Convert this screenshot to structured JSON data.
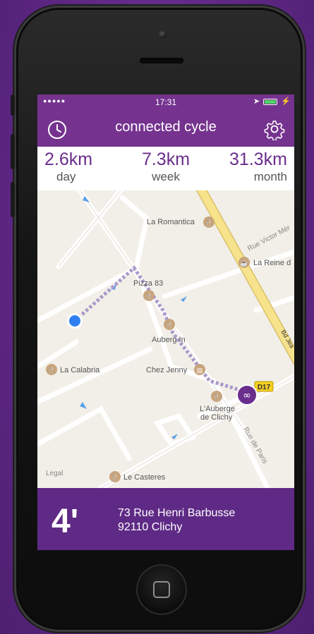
{
  "status_bar": {
    "signal": "●●●●●",
    "time": "17:31",
    "location_icon": "location-arrow-icon",
    "battery_icon": "battery-icon",
    "charging_icon": "bolt-icon"
  },
  "nav": {
    "title": "connected cycle",
    "left_icon": "clock-icon",
    "right_icon": "gear-icon"
  },
  "stats": [
    {
      "value": "2.6km",
      "label": "day"
    },
    {
      "value": "7.3km",
      "label": "week"
    },
    {
      "value": "31.3km",
      "label": "month"
    }
  ],
  "map": {
    "places": [
      {
        "name": "La Romantica"
      },
      {
        "name": "La Reine d"
      },
      {
        "name": "Pizza 83"
      },
      {
        "name": "Auberg In"
      },
      {
        "name": "La Calabria"
      },
      {
        "name": "Chez Jenny"
      },
      {
        "name": "L'Auberge de Clichy"
      },
      {
        "name": "Le Casteres"
      }
    ],
    "streets": [
      "Rue Victor Mér",
      "Bd Jea",
      "Rue de Paris"
    ],
    "road_badge": "D17",
    "legal": "Legal"
  },
  "bottom": {
    "duration": "4'",
    "address_line1": "73 Rue Henri Barbusse",
    "address_line2": "92110 Clichy"
  },
  "colors": {
    "brand_purple": "#75338f",
    "bottom_purple": "#5f2a86",
    "stat_text": "#6a2e8c",
    "user_dot": "#2f7ff0",
    "route": "#9a8cc0",
    "main_road": "#f7e38c"
  }
}
